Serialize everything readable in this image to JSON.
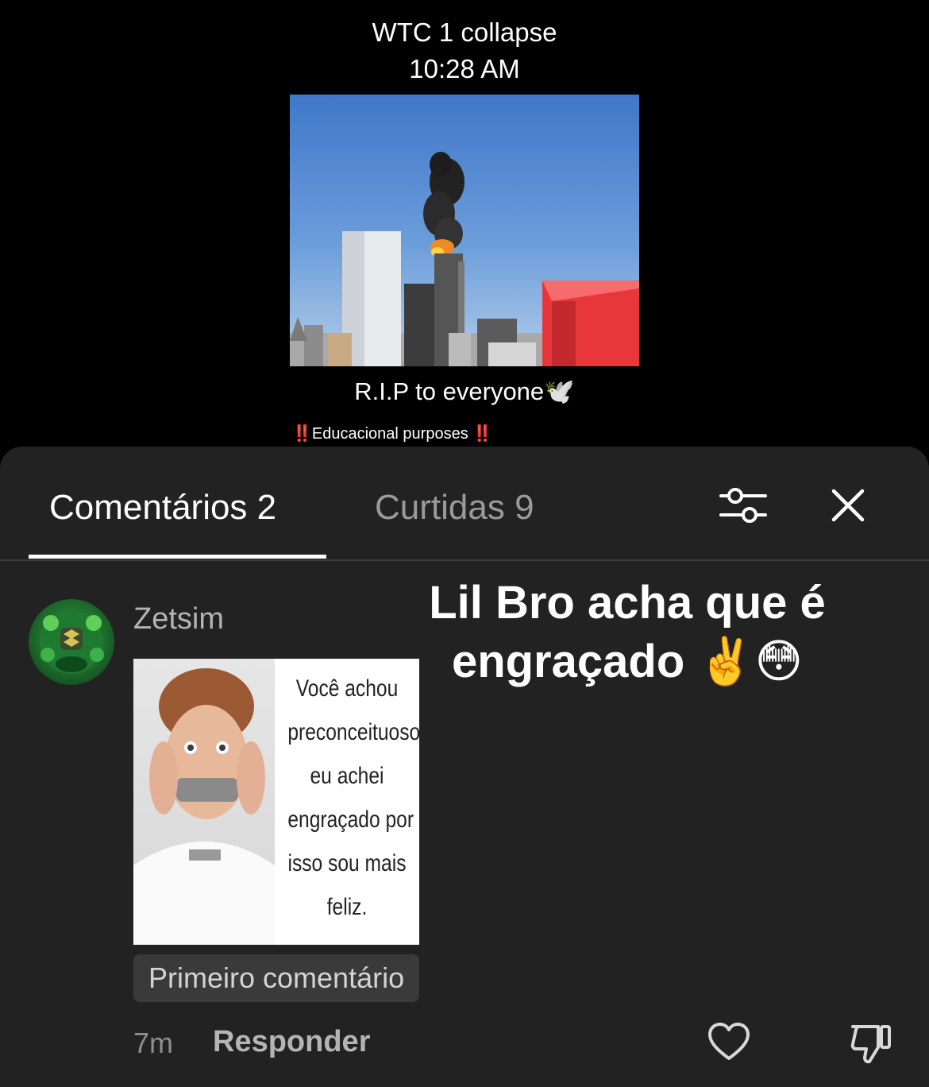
{
  "video": {
    "title": "WTC 1 collapse",
    "time": "10:28 AM",
    "caption": "R.I.P to everyone🕊️",
    "edu_prefix": "‼️",
    "edu_text": "Educacional purposes ",
    "edu_suffix": "‼️"
  },
  "comments_panel": {
    "tab_comments": "Comentários 2",
    "tab_likes": "Curtidas 9",
    "filter_icon": "sliders-icon",
    "close_icon": "close-icon"
  },
  "overlay": {
    "line1": "Lil Bro acha que é",
    "line2": "engraçado ✌️😳"
  },
  "comment": {
    "username": "Zetsim",
    "meme_lines": [
      "Você achou",
      "preconceituoso",
      "eu achei",
      "engraçado por",
      "isso sou mais",
      "feliz."
    ],
    "badge": "Primeiro comentário",
    "timestamp": "7m",
    "reply_label": "Responder",
    "like_icon": "heart-icon",
    "dislike_icon": "thumbs-down-icon"
  },
  "colors": {
    "background": "#000000",
    "sheet": "#222222",
    "tab_active": "#ffffff",
    "tab_inactive": "#9a9a9a",
    "badge_bg": "#3a3a3a",
    "alert_red": "#e23a3a"
  }
}
